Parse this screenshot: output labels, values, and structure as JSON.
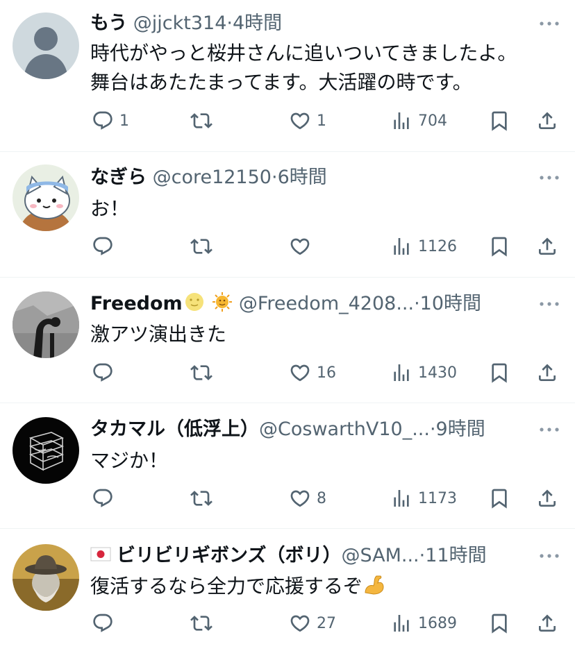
{
  "colors": {
    "text": "#0f1419",
    "secondary": "#536471",
    "divider": "#eff3f4"
  },
  "tweets": [
    {
      "name": "もう",
      "handle": "@jjckt314",
      "dot": "·",
      "time": "4時間",
      "avatar": "default-avatar",
      "text": "時代がやっと桜井さんに追いついてきましたよ。\n舞台はあたたまってます。大活躍の時です。",
      "reply_count": "1",
      "retweet_count": "",
      "like_count": "1",
      "view_count": "704"
    },
    {
      "name": "なぎら",
      "handle": "@core12150",
      "dot": "·",
      "time": "6時間",
      "avatar": "cat-character-avatar",
      "text": "お！",
      "reply_count": "",
      "retweet_count": "",
      "like_count": "",
      "view_count": "1126"
    },
    {
      "name": "Freedom",
      "name_emojis": [
        "full-moon-face-emoji",
        "sun-with-face-emoji"
      ],
      "handle": "@Freedom_4208...",
      "dot": "·",
      "time": "10時間",
      "avatar": "silhouette-photo-avatar",
      "text": "激アツ演出きた",
      "reply_count": "",
      "retweet_count": "",
      "like_count": "16",
      "view_count": "1430"
    },
    {
      "name": "タカマル（低浮上）",
      "handle": "@CoswarthV10_...",
      "dot": "·",
      "time": "9時間",
      "avatar": "dark-sketch-avatar",
      "text": "マジか！",
      "reply_count": "",
      "retweet_count": "",
      "like_count": "8",
      "view_count": "1173"
    },
    {
      "name": "ビリビリギボンズ（ボリ）",
      "name_prefix_emoji": "japan-flag-emoji",
      "handle": "@SAM...",
      "dot": "·",
      "time": "11時間",
      "avatar": "hat-photo-avatar",
      "text": "復活するなら全力で応援するぞ",
      "text_emoji": "flexed-biceps-emoji",
      "reply_count": "",
      "retweet_count": "",
      "like_count": "27",
      "view_count": "1689"
    }
  ]
}
